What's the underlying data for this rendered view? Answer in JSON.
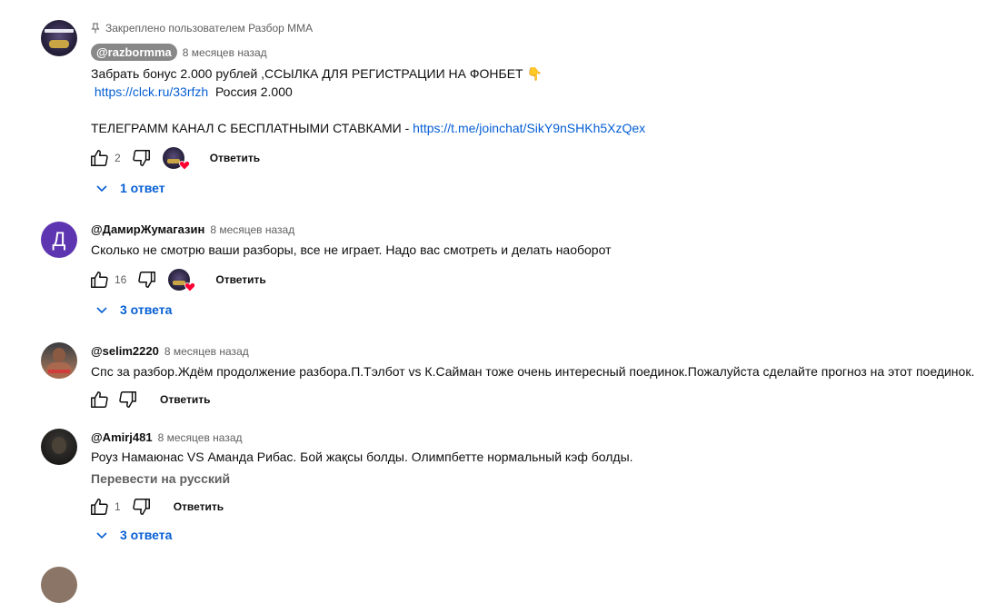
{
  "comments": [
    {
      "pinned_text": "Закреплено пользователем Разбор ММА",
      "author": "@razbormma",
      "time": "8 месяцев назад",
      "line1": "Забрать бонус 2.000 рублей ,ССЫЛКА ДЛЯ РЕГИСТРАЦИИ НА ФОНБЕТ 👇",
      "link1": "https://clck.ru/33rfzh",
      "line2_suffix": "  Россия 2.000",
      "line3_prefix": "ТЕЛЕГРАММ КАНАЛ С БЕСПЛАТНЫМИ СТАВКАМИ - ",
      "link2": "https://t.me/joinchat/SikY9nSHKh5XzQex",
      "likes": "2",
      "reply_label": "Ответить",
      "replies_label": "1 ответ"
    },
    {
      "avatar_letter": "Д",
      "author": "@ДамирЖумагазин",
      "time": "8 месяцев назад",
      "text": "Сколько не смотрю ваши разборы, все не играет. Надо вас смотреть и делать наоборот",
      "likes": "16",
      "reply_label": "Ответить",
      "replies_label": "3 ответа"
    },
    {
      "author": "@selim2220",
      "time": "8 месяцев назад",
      "text": "Спс за разбор.Ждём продолжение разбора.П.Тэлбот vs К.Сайман тоже очень интересный поединок.Пожалуйста сделайте прогноз на этот поединок.",
      "reply_label": "Ответить"
    },
    {
      "author": "@Amirj481",
      "time": "8 месяцев назад",
      "text": "Роуз Намаюнас VS Аманда Рибас. Бой жақсы болды. Олимпбетте нормальный кэф болды.",
      "translate_label": "Перевести на русский",
      "likes": "1",
      "reply_label": "Ответить",
      "replies_label": "3 ответа"
    }
  ],
  "colors": {
    "link": "#065fd4",
    "secondary_text": "#606060",
    "author_badge": "#888888",
    "heart": "#ff0033"
  },
  "icons": [
    "pin-icon",
    "thumb-up-icon",
    "thumb-down-icon",
    "heart-icon",
    "chevron-down-icon"
  ]
}
